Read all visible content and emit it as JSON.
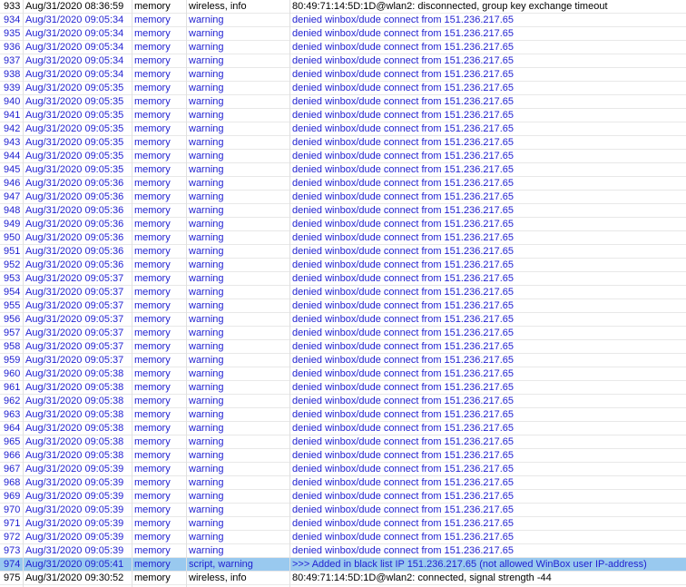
{
  "log": {
    "selected_id": "974",
    "rows": [
      {
        "id": "933",
        "time": "Aug/31/2020 08:36:59",
        "buffer": "memory",
        "topics": "wireless, info",
        "message": "80:49:71:14:5D:1D@wlan2: disconnected, group key exchange timeout",
        "level": "info"
      },
      {
        "id": "934",
        "time": "Aug/31/2020 09:05:34",
        "buffer": "memory",
        "topics": "warning",
        "message": "denied winbox/dude connect from 151.236.217.65",
        "level": "warning"
      },
      {
        "id": "935",
        "time": "Aug/31/2020 09:05:34",
        "buffer": "memory",
        "topics": "warning",
        "message": "denied winbox/dude connect from 151.236.217.65",
        "level": "warning"
      },
      {
        "id": "936",
        "time": "Aug/31/2020 09:05:34",
        "buffer": "memory",
        "topics": "warning",
        "message": "denied winbox/dude connect from 151.236.217.65",
        "level": "warning"
      },
      {
        "id": "937",
        "time": "Aug/31/2020 09:05:34",
        "buffer": "memory",
        "topics": "warning",
        "message": "denied winbox/dude connect from 151.236.217.65",
        "level": "warning"
      },
      {
        "id": "938",
        "time": "Aug/31/2020 09:05:34",
        "buffer": "memory",
        "topics": "warning",
        "message": "denied winbox/dude connect from 151.236.217.65",
        "level": "warning"
      },
      {
        "id": "939",
        "time": "Aug/31/2020 09:05:35",
        "buffer": "memory",
        "topics": "warning",
        "message": "denied winbox/dude connect from 151.236.217.65",
        "level": "warning"
      },
      {
        "id": "940",
        "time": "Aug/31/2020 09:05:35",
        "buffer": "memory",
        "topics": "warning",
        "message": "denied winbox/dude connect from 151.236.217.65",
        "level": "warning"
      },
      {
        "id": "941",
        "time": "Aug/31/2020 09:05:35",
        "buffer": "memory",
        "topics": "warning",
        "message": "denied winbox/dude connect from 151.236.217.65",
        "level": "warning"
      },
      {
        "id": "942",
        "time": "Aug/31/2020 09:05:35",
        "buffer": "memory",
        "topics": "warning",
        "message": "denied winbox/dude connect from 151.236.217.65",
        "level": "warning"
      },
      {
        "id": "943",
        "time": "Aug/31/2020 09:05:35",
        "buffer": "memory",
        "topics": "warning",
        "message": "denied winbox/dude connect from 151.236.217.65",
        "level": "warning"
      },
      {
        "id": "944",
        "time": "Aug/31/2020 09:05:35",
        "buffer": "memory",
        "topics": "warning",
        "message": "denied winbox/dude connect from 151.236.217.65",
        "level": "warning"
      },
      {
        "id": "945",
        "time": "Aug/31/2020 09:05:35",
        "buffer": "memory",
        "topics": "warning",
        "message": "denied winbox/dude connect from 151.236.217.65",
        "level": "warning"
      },
      {
        "id": "946",
        "time": "Aug/31/2020 09:05:36",
        "buffer": "memory",
        "topics": "warning",
        "message": "denied winbox/dude connect from 151.236.217.65",
        "level": "warning"
      },
      {
        "id": "947",
        "time": "Aug/31/2020 09:05:36",
        "buffer": "memory",
        "topics": "warning",
        "message": "denied winbox/dude connect from 151.236.217.65",
        "level": "warning"
      },
      {
        "id": "948",
        "time": "Aug/31/2020 09:05:36",
        "buffer": "memory",
        "topics": "warning",
        "message": "denied winbox/dude connect from 151.236.217.65",
        "level": "warning"
      },
      {
        "id": "949",
        "time": "Aug/31/2020 09:05:36",
        "buffer": "memory",
        "topics": "warning",
        "message": "denied winbox/dude connect from 151.236.217.65",
        "level": "warning"
      },
      {
        "id": "950",
        "time": "Aug/31/2020 09:05:36",
        "buffer": "memory",
        "topics": "warning",
        "message": "denied winbox/dude connect from 151.236.217.65",
        "level": "warning"
      },
      {
        "id": "951",
        "time": "Aug/31/2020 09:05:36",
        "buffer": "memory",
        "topics": "warning",
        "message": "denied winbox/dude connect from 151.236.217.65",
        "level": "warning"
      },
      {
        "id": "952",
        "time": "Aug/31/2020 09:05:36",
        "buffer": "memory",
        "topics": "warning",
        "message": "denied winbox/dude connect from 151.236.217.65",
        "level": "warning"
      },
      {
        "id": "953",
        "time": "Aug/31/2020 09:05:37",
        "buffer": "memory",
        "topics": "warning",
        "message": "denied winbox/dude connect from 151.236.217.65",
        "level": "warning"
      },
      {
        "id": "954",
        "time": "Aug/31/2020 09:05:37",
        "buffer": "memory",
        "topics": "warning",
        "message": "denied winbox/dude connect from 151.236.217.65",
        "level": "warning"
      },
      {
        "id": "955",
        "time": "Aug/31/2020 09:05:37",
        "buffer": "memory",
        "topics": "warning",
        "message": "denied winbox/dude connect from 151.236.217.65",
        "level": "warning"
      },
      {
        "id": "956",
        "time": "Aug/31/2020 09:05:37",
        "buffer": "memory",
        "topics": "warning",
        "message": "denied winbox/dude connect from 151.236.217.65",
        "level": "warning"
      },
      {
        "id": "957",
        "time": "Aug/31/2020 09:05:37",
        "buffer": "memory",
        "topics": "warning",
        "message": "denied winbox/dude connect from 151.236.217.65",
        "level": "warning"
      },
      {
        "id": "958",
        "time": "Aug/31/2020 09:05:37",
        "buffer": "memory",
        "topics": "warning",
        "message": "denied winbox/dude connect from 151.236.217.65",
        "level": "warning"
      },
      {
        "id": "959",
        "time": "Aug/31/2020 09:05:37",
        "buffer": "memory",
        "topics": "warning",
        "message": "denied winbox/dude connect from 151.236.217.65",
        "level": "warning"
      },
      {
        "id": "960",
        "time": "Aug/31/2020 09:05:38",
        "buffer": "memory",
        "topics": "warning",
        "message": "denied winbox/dude connect from 151.236.217.65",
        "level": "warning"
      },
      {
        "id": "961",
        "time": "Aug/31/2020 09:05:38",
        "buffer": "memory",
        "topics": "warning",
        "message": "denied winbox/dude connect from 151.236.217.65",
        "level": "warning"
      },
      {
        "id": "962",
        "time": "Aug/31/2020 09:05:38",
        "buffer": "memory",
        "topics": "warning",
        "message": "denied winbox/dude connect from 151.236.217.65",
        "level": "warning"
      },
      {
        "id": "963",
        "time": "Aug/31/2020 09:05:38",
        "buffer": "memory",
        "topics": "warning",
        "message": "denied winbox/dude connect from 151.236.217.65",
        "level": "warning"
      },
      {
        "id": "964",
        "time": "Aug/31/2020 09:05:38",
        "buffer": "memory",
        "topics": "warning",
        "message": "denied winbox/dude connect from 151.236.217.65",
        "level": "warning"
      },
      {
        "id": "965",
        "time": "Aug/31/2020 09:05:38",
        "buffer": "memory",
        "topics": "warning",
        "message": "denied winbox/dude connect from 151.236.217.65",
        "level": "warning"
      },
      {
        "id": "966",
        "time": "Aug/31/2020 09:05:38",
        "buffer": "memory",
        "topics": "warning",
        "message": "denied winbox/dude connect from 151.236.217.65",
        "level": "warning"
      },
      {
        "id": "967",
        "time": "Aug/31/2020 09:05:39",
        "buffer": "memory",
        "topics": "warning",
        "message": "denied winbox/dude connect from 151.236.217.65",
        "level": "warning"
      },
      {
        "id": "968",
        "time": "Aug/31/2020 09:05:39",
        "buffer": "memory",
        "topics": "warning",
        "message": "denied winbox/dude connect from 151.236.217.65",
        "level": "warning"
      },
      {
        "id": "969",
        "time": "Aug/31/2020 09:05:39",
        "buffer": "memory",
        "topics": "warning",
        "message": "denied winbox/dude connect from 151.236.217.65",
        "level": "warning"
      },
      {
        "id": "970",
        "time": "Aug/31/2020 09:05:39",
        "buffer": "memory",
        "topics": "warning",
        "message": "denied winbox/dude connect from 151.236.217.65",
        "level": "warning"
      },
      {
        "id": "971",
        "time": "Aug/31/2020 09:05:39",
        "buffer": "memory",
        "topics": "warning",
        "message": "denied winbox/dude connect from 151.236.217.65",
        "level": "warning"
      },
      {
        "id": "972",
        "time": "Aug/31/2020 09:05:39",
        "buffer": "memory",
        "topics": "warning",
        "message": "denied winbox/dude connect from 151.236.217.65",
        "level": "warning"
      },
      {
        "id": "973",
        "time": "Aug/31/2020 09:05:39",
        "buffer": "memory",
        "topics": "warning",
        "message": "denied winbox/dude connect from 151.236.217.65",
        "level": "warning"
      },
      {
        "id": "974",
        "time": "Aug/31/2020 09:05:41",
        "buffer": "memory",
        "topics": "script, warning",
        "message": ">>> Added in black list IP 151.236.217.65 (not allowed WinBox user IP-address)",
        "level": "warning"
      },
      {
        "id": "975",
        "time": "Aug/31/2020 09:30:52",
        "buffer": "memory",
        "topics": "wireless, info",
        "message": "80:49:71:14:5D:1D@wlan2: connected, signal strength -44",
        "level": "info"
      }
    ]
  },
  "colors": {
    "warning_text": "#1f1fd1",
    "info_text": "#000000",
    "selected_row_background": "#99c9ef"
  }
}
